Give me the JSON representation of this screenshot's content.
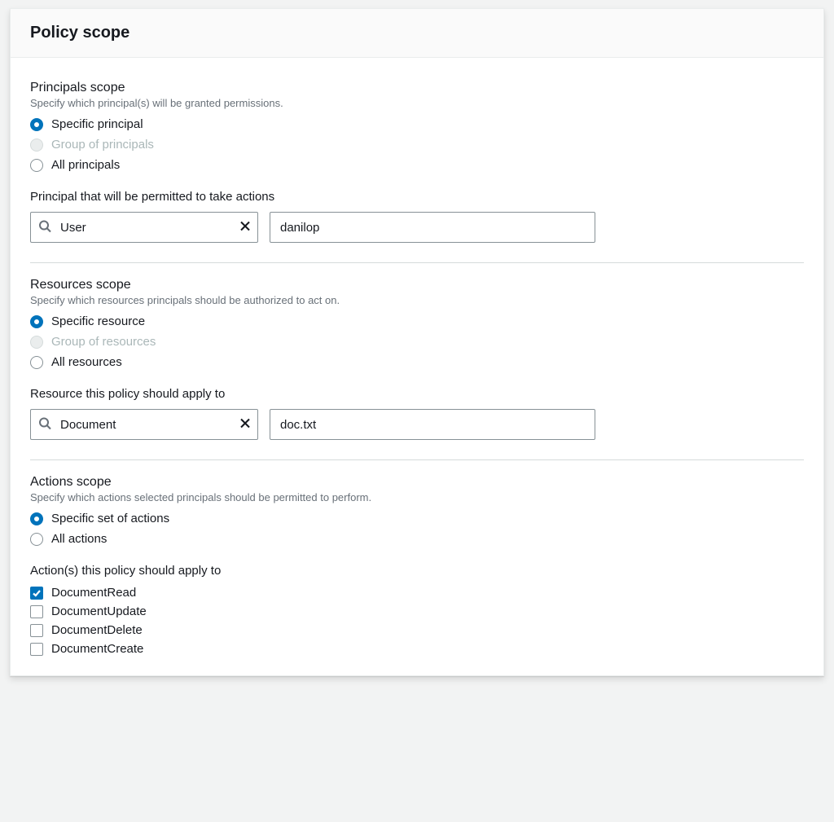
{
  "header": {
    "title": "Policy scope"
  },
  "principals": {
    "title": "Principals scope",
    "desc": "Specify which principal(s) will be granted permissions.",
    "options": {
      "specific": "Specific principal",
      "group": "Group of principals",
      "all": "All principals"
    },
    "field_label": "Principal that will be permitted to take actions",
    "type_value": "User",
    "name_value": "danilop"
  },
  "resources": {
    "title": "Resources scope",
    "desc": "Specify which resources principals should be authorized to act on.",
    "options": {
      "specific": "Specific resource",
      "group": "Group of resources",
      "all": "All resources"
    },
    "field_label": "Resource this policy should apply to",
    "type_value": "Document",
    "name_value": "doc.txt"
  },
  "actions": {
    "title": "Actions scope",
    "desc": "Specify which actions selected principals should be permitted to perform.",
    "options": {
      "specific": "Specific set of actions",
      "all": "All actions"
    },
    "field_label": "Action(s) this policy should apply to",
    "items": [
      {
        "label": "DocumentRead",
        "checked": true
      },
      {
        "label": "DocumentUpdate",
        "checked": false
      },
      {
        "label": "DocumentDelete",
        "checked": false
      },
      {
        "label": "DocumentCreate",
        "checked": false
      }
    ]
  }
}
